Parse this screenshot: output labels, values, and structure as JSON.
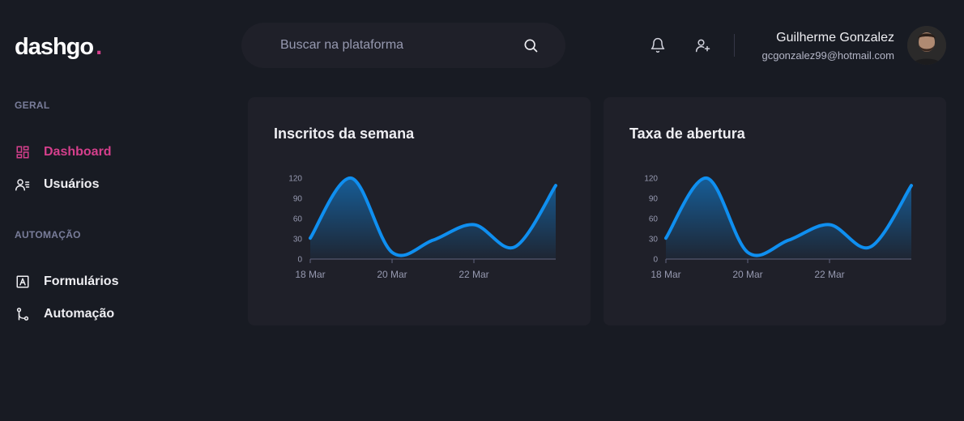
{
  "app": {
    "logo_text": "dashgo",
    "logo_dot": "."
  },
  "search": {
    "placeholder": "Buscar na plataforma"
  },
  "header": {
    "icons": [
      "bell-icon",
      "user-add-icon",
      "search-icon"
    ]
  },
  "profile": {
    "name": "Guilherme Gonzalez",
    "email": "gcgonzalez99@hotmail.com"
  },
  "sidebar": {
    "sections": [
      {
        "title": "GERAL",
        "items": [
          {
            "label": "Dashboard",
            "icon": "dashboard-icon",
            "active": true
          },
          {
            "label": "Usuários",
            "icon": "users-icon",
            "active": false
          }
        ]
      },
      {
        "title": "AUTOMAÇÃO",
        "items": [
          {
            "label": "Formulários",
            "icon": "form-icon",
            "active": false
          },
          {
            "label": "Automação",
            "icon": "git-merge-icon",
            "active": false
          }
        ]
      }
    ]
  },
  "colors": {
    "accent": "#d53f8c",
    "line": "#0f8ff0",
    "background": "#181b23",
    "card": "#1f2029"
  },
  "cards": [
    {
      "title": "Inscritos da semana"
    },
    {
      "title": "Taxa de abertura"
    }
  ],
  "chart_data": [
    {
      "type": "area",
      "title": "Inscritos da semana",
      "x": [
        "2021-03-18",
        "2021-03-19",
        "2021-03-20",
        "2021-03-21",
        "2021-03-22",
        "2021-03-23",
        "2021-03-24"
      ],
      "x_tick_labels": [
        "18 Mar",
        "20 Mar",
        "22 Mar"
      ],
      "y_ticks": [
        0,
        30,
        60,
        90,
        120
      ],
      "ylim": [
        0,
        120
      ],
      "series": [
        {
          "values": [
            31,
            120,
            10,
            28,
            51,
            18,
            109
          ]
        }
      ],
      "grid": false
    },
    {
      "type": "area",
      "title": "Taxa de abertura",
      "x": [
        "2021-03-18",
        "2021-03-19",
        "2021-03-20",
        "2021-03-21",
        "2021-03-22",
        "2021-03-23",
        "2021-03-24"
      ],
      "x_tick_labels": [
        "18 Mar",
        "20 Mar",
        "22 Mar"
      ],
      "y_ticks": [
        0,
        30,
        60,
        90,
        120
      ],
      "ylim": [
        0,
        120
      ],
      "series": [
        {
          "values": [
            31,
            120,
            10,
            28,
            51,
            18,
            109
          ]
        }
      ],
      "grid": false
    }
  ]
}
